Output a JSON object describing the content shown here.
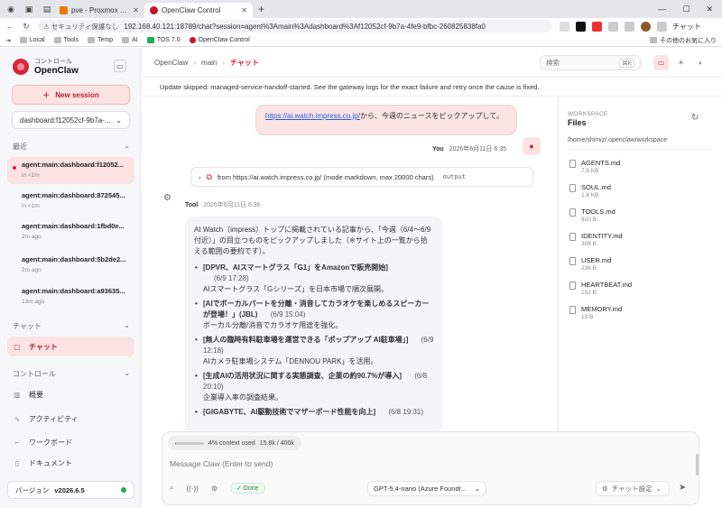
{
  "browser": {
    "tabs": [
      {
        "label": "pve - Proxmox Virtual Environment",
        "active": false,
        "color": "#e57a00"
      },
      {
        "label": "OpenClaw Control",
        "active": true,
        "color": "#c8102e"
      }
    ],
    "url_warning": "セキュリティ保護なし",
    "url": "192.168.40.121:18789/chat?session=agent%3Amain%3Adashboard%3Af12052cf-9b7a-4fe9-bfbc-260825838fa0",
    "bookmarks": [
      "Local",
      "Tools",
      "Temp",
      "AI",
      "TOS 7.0",
      "OpenClaw Control"
    ],
    "other_bookmarks": "その他のお気に入り",
    "chat_ext": "チャット"
  },
  "sidebar": {
    "brand_sub": "コントロール",
    "brand_name": "OpenClaw",
    "new_session": "New session",
    "session_select": "dashboard:f12052cf-9b7a-...",
    "recent_title": "最近",
    "sessions": [
      {
        "title": "agent:main:dashboard:f12052...",
        "sub": "in <1m"
      },
      {
        "title": "agent:main:dashboard:872545...",
        "sub": "in <1m"
      },
      {
        "title": "agent:main:dashboard:1fbd0e...",
        "sub": "2m ago"
      },
      {
        "title": "agent:main:dashboard:5b2de2...",
        "sub": "2m ago"
      },
      {
        "title": "agent:main:dashboard:a93635...",
        "sub": "13m ago"
      }
    ],
    "chat_title": "チャット",
    "chat_item": "チャット",
    "control_title": "コントロール",
    "control_items": [
      "概要",
      "アクティビティ",
      "ワークボード"
    ],
    "docs": "ドキュメント",
    "version_label": "バージョン",
    "version_value": "v2026.6.5"
  },
  "topbar": {
    "crumbs": [
      "OpenClaw",
      "main",
      "チャット"
    ],
    "search_placeholder": "検索",
    "search_key": "⌘K"
  },
  "banner": "Update skipped: managed-service-handoff-started. See the gateway logs for the exact failure and retry once the cause is fixed.",
  "chat": {
    "user_link": "https://ai.watch.impress.co.jp/",
    "user_text": "から、今週のニュースをピックアップして。",
    "user_name": "You",
    "user_time": "2026年6月11日 6:35",
    "tool_call": "from https://ai.watch.impress.co.jp/ (mode markdown, max 20000 chars)",
    "tool_output": "output",
    "tool_name": "Tool",
    "tool_time": "2026年6月11日 6:36",
    "tool_intro": "AI Watch（impress）トップに掲載されている記事から、「今週（6/4〜6/9付近）」の目立つものをピックアップしました（※サイト上の一覧から拾える範囲の要約です）。",
    "items": [
      {
        "head": "[DPVR、AIスマートグラス「G1」をAmazonで販売開始]",
        "date": "(6/9 17:28)",
        "body": "AIスマートグラス「Gシリーズ」を日本市場で順次展開。"
      },
      {
        "head": "[AIでボーカルパートを分離・消音してカラオケを楽しめるスピーカーが登場！」(JBL)",
        "date": "(6/9 15:04)",
        "body": "ボーカル分離/消音でカラオケ用途を強化。"
      },
      {
        "head": "[無人の臨時有料駐車場を運営できる「ポップアップ AI駐車場」]",
        "date": "(6/9 12:18)",
        "body": "AIカメラ駐車場システム「DENNOU PARK」を活用。"
      },
      {
        "head": "[生成AIの活用状況に関する実態調査、企業の約90.7%が導入]",
        "date": "(6/8 20:10)",
        "body": "企業導入率の調査結果。"
      },
      {
        "head": "[GIGABYTE、AI駆動技術でマザーボード性能を向上]",
        "date": "(6/8 19:31)",
        "body": ""
      }
    ]
  },
  "files": {
    "ws_label": "WORKSPACE",
    "title": "Files",
    "path": "/home/shimiz/.openclaw/workspace",
    "list": [
      {
        "name": "AGENTS.md",
        "size": "7.9 KB"
      },
      {
        "name": "SOUL.md",
        "size": "1.8 KB"
      },
      {
        "name": "TOOLS.md",
        "size": "920 B"
      },
      {
        "name": "IDENTITY.md",
        "size": "308 B"
      },
      {
        "name": "USER.md",
        "size": "236 B"
      },
      {
        "name": "HEARTBEAT.md",
        "size": "152 B"
      },
      {
        "name": "MEMORY.md",
        "size": "13 B"
      }
    ]
  },
  "composer": {
    "context": "4% context used",
    "context_pct": 4,
    "tokens": "15.8k / 400k",
    "placeholder": "Message Claw (Enter to send)",
    "done": "Done",
    "model": "GPT-5.4-nano (Azure Foundr...",
    "chat_settings": "チャット設定"
  },
  "colors": {
    "accent": "#d7263d",
    "accent_soft": "#fbe3e3",
    "status_ok": "#1fae51"
  }
}
